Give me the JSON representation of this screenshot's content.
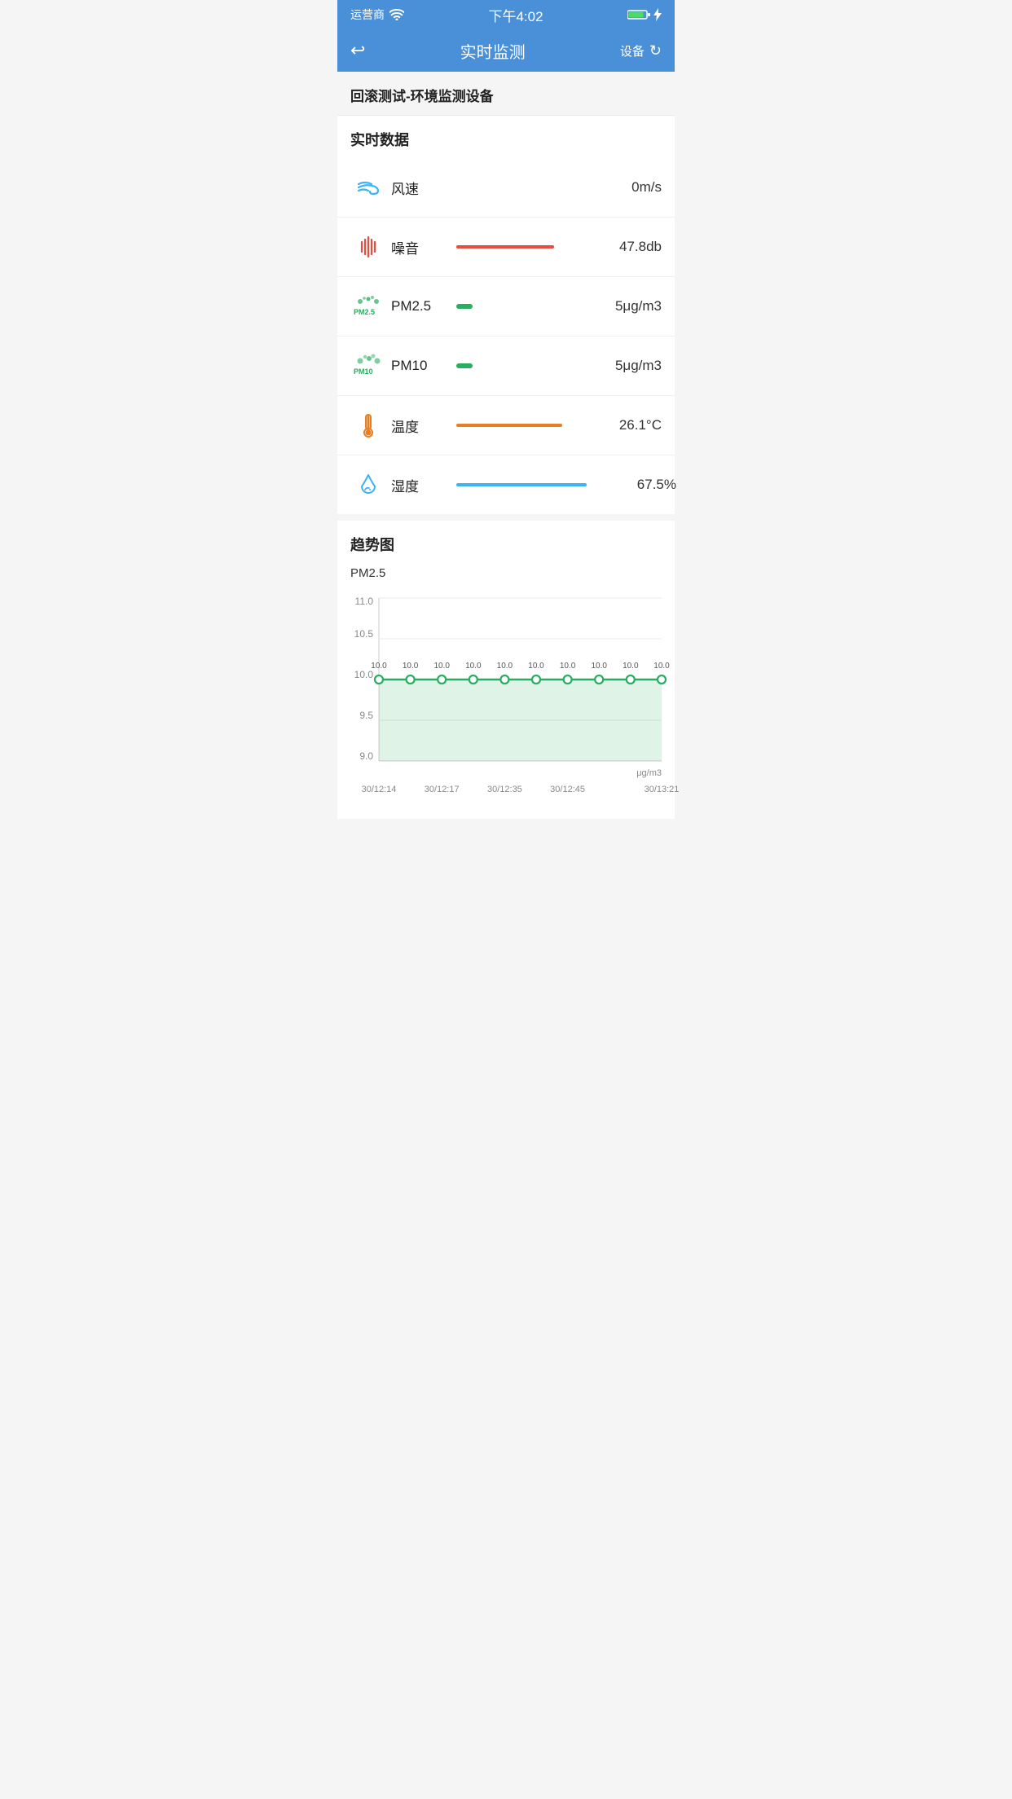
{
  "statusBar": {
    "carrier": "运营商",
    "time": "下午4:02"
  },
  "navBar": {
    "backLabel": "返回",
    "title": "实时监测",
    "deviceLabel": "设备",
    "refreshIcon": "refresh"
  },
  "deviceName": "回滚测试-环境监测设备",
  "realtimeSection": {
    "label": "实时数据",
    "rows": [
      {
        "id": "wind",
        "name": "风速",
        "value": "0m/s",
        "barType": "none"
      },
      {
        "id": "noise",
        "name": "噪音",
        "value": "47.8db",
        "barType": "red"
      },
      {
        "id": "pm25",
        "name": "PM2.5",
        "value": "5μg/m3",
        "barType": "green-short"
      },
      {
        "id": "pm10",
        "name": "PM10",
        "value": "5μg/m3",
        "barType": "green-short"
      },
      {
        "id": "temp",
        "name": "温度",
        "value": "26.1°C",
        "barType": "orange"
      },
      {
        "id": "humidity",
        "name": "湿度",
        "value": "67.5%",
        "barType": "blue"
      }
    ]
  },
  "trendSection": {
    "label": "趋势图",
    "chartTitle": "PM2.5",
    "yAxis": {
      "max": 11.0,
      "mid1": 10.5,
      "mid2": 10.0,
      "mid3": 9.5,
      "min": 9.0
    },
    "unit": "μg/m3",
    "dataPoints": [
      {
        "label": "30/12:14",
        "value": 10.0
      },
      {
        "label": "30/12:17",
        "value": 10.0
      },
      {
        "label": "30/12:35",
        "value": 10.0
      },
      {
        "label": "30/12:45",
        "value": 10.0
      },
      {
        "label": "",
        "value": 10.0
      },
      {
        "label": "",
        "value": 10.0
      },
      {
        "label": "",
        "value": 10.0
      },
      {
        "label": "",
        "value": 10.0
      },
      {
        "label": "",
        "value": 10.0
      },
      {
        "label": "30/13:21",
        "value": 10.0
      }
    ],
    "xLabels": [
      "30/12:14",
      "30/12:17",
      "30/12:35",
      "30/12:45",
      "30/13:21"
    ]
  }
}
